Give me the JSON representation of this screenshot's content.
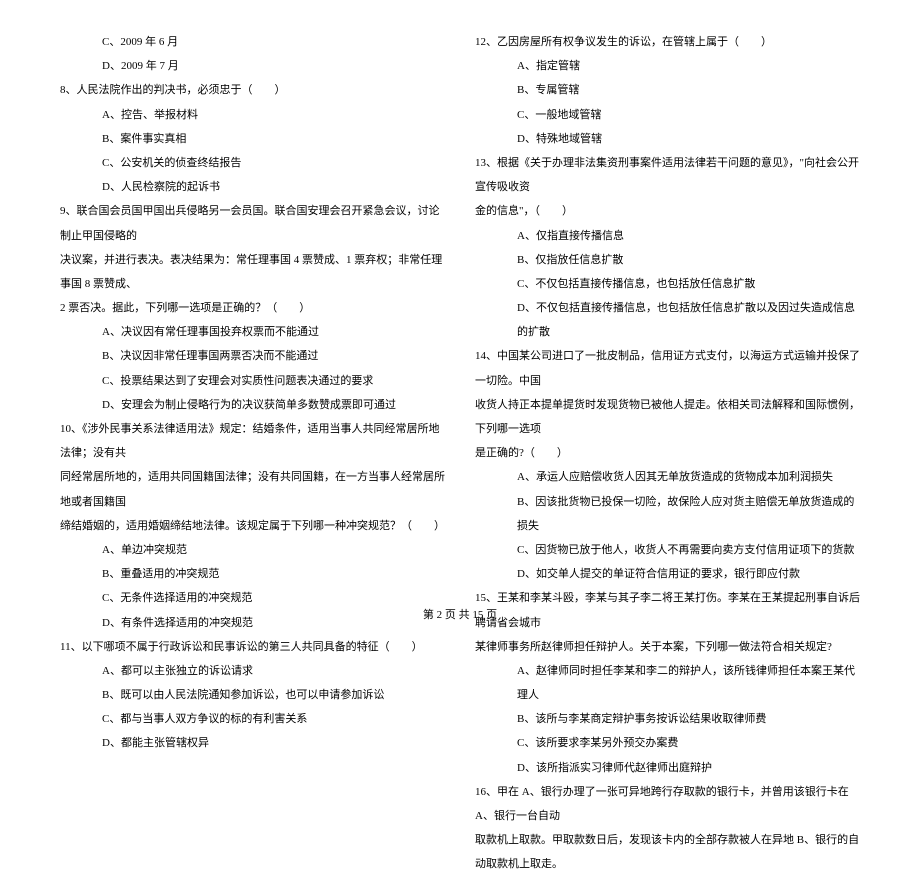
{
  "left": {
    "q7_optC": "C、2009 年 6 月",
    "q7_optD": "D、2009 年 7 月",
    "q8": "8、人民法院作出的判决书，必须忠于（　　）",
    "q8_A": "A、控告、举报材料",
    "q8_B": "B、案件事实真相",
    "q8_C": "C、公安机关的侦查终结报告",
    "q8_D": "D、人民检察院的起诉书",
    "q9_line1": "9、联合国会员国甲国出兵侵略另一会员国。联合国安理会召开紧急会议，讨论制止甲国侵略的",
    "q9_line2": "决议案，并进行表决。表决结果为：常任理事国 4 票赞成、1 票弃权；非常任理事国 8 票赞成、",
    "q9_line3": "2 票否决。据此，下列哪一选项是正确的？（　　）",
    "q9_A": "A、决议因有常任理事国投弃权票而不能通过",
    "q9_B": "B、决议因非常任理事国两票否决而不能通过",
    "q9_C": "C、投票结果达到了安理会对实质性问题表决通过的要求",
    "q9_D": "D、安理会为制止侵略行为的决议获简单多数赞成票即可通过",
    "q10_line1": "10、《涉外民事关系法律适用法》规定：结婚条件，适用当事人共同经常居所地法律；没有共",
    "q10_line2": "同经常居所地的，适用共同国籍国法律；没有共同国籍，在一方当事人经常居所地或者国籍国",
    "q10_line3": "缔结婚姻的，适用婚姻缔结地法律。该规定属于下列哪一种冲突规范？（　　）",
    "q10_A": "A、单边冲突规范",
    "q10_B": "B、重叠适用的冲突规范",
    "q10_C": "C、无条件选择适用的冲突规范",
    "q10_D": "D、有条件选择适用的冲突规范",
    "q11": "11、以下哪项不属于行政诉讼和民事诉讼的第三人共同具备的特征（　　）",
    "q11_A": "A、都可以主张独立的诉讼请求",
    "q11_B": "B、既可以由人民法院通知参加诉讼，也可以申请参加诉讼",
    "q11_C": "C、都与当事人双方争议的标的有利害关系",
    "q11_D": "D、都能主张管辖权异"
  },
  "right": {
    "q12": "12、乙因房屋所有权争议发生的诉讼，在管辖上属于（　　）",
    "q12_A": "A、指定管辖",
    "q12_B": "B、专属管辖",
    "q12_C": "C、一般地域管辖",
    "q12_D": "D、特殊地域管辖",
    "q13_line1": "13、根据《关于办理非法集资刑事案件适用法律若干问题的意见》，\"向社会公开宣传吸收资",
    "q13_line2": "金的信息\"，（　　）",
    "q13_A": "A、仅指直接传播信息",
    "q13_B": "B、仅指放任信息扩散",
    "q13_C": "C、不仅包括直接传播信息，也包括放任信息扩散",
    "q13_D": "D、不仅包括直接传播信息，也包括放任信息扩散以及因过失造成信息的扩散",
    "q14_line1": "14、中国某公司进口了一批皮制品，信用证方式支付，以海运方式运输并投保了一切险。中国",
    "q14_line2": "收货人持正本提单提货时发现货物已被他人提走。依相关司法解释和国际惯例，下列哪一选项",
    "q14_line3": "是正确的?（　　）",
    "q14_A": "A、承运人应赔偿收货人因其无单放货造成的货物成本加利润损失",
    "q14_B": "B、因该批货物已投保一切险，故保险人应对货主赔偿无单放货造成的损失",
    "q14_C": "C、因货物已放于他人，收货人不再需要向卖方支付信用证项下的货款",
    "q14_D": "D、如交单人提交的单证符合信用证的要求，银行即应付款",
    "q15_line1": "15、王某和李某斗殴，李某与其子李二将王某打伤。李某在王某提起刑事自诉后聘请省会城市",
    "q15_line2": "某律师事务所赵律师担任辩护人。关于本案，下列哪一做法符合相关规定?",
    "q15_A": "A、赵律师同时担任李某和李二的辩护人，该所钱律师担任本案王某代理人",
    "q15_B": "B、该所与李某商定辩护事务按诉讼结果收取律师费",
    "q15_C": "C、该所要求李某另外预交办案费",
    "q15_D": "D、该所指派实习律师代赵律师出庭辩护",
    "q16_line1": "16、甲在 A、银行办理了一张可异地跨行存取款的银行卡，并曾用该银行卡在 A、银行一台自动",
    "q16_line2": "取款机上取款。甲取款数日后，发现该卡内的全部存款被人在异地 B、银行的自动取款机上取走。"
  },
  "footer": "第 2 页 共 15 页"
}
